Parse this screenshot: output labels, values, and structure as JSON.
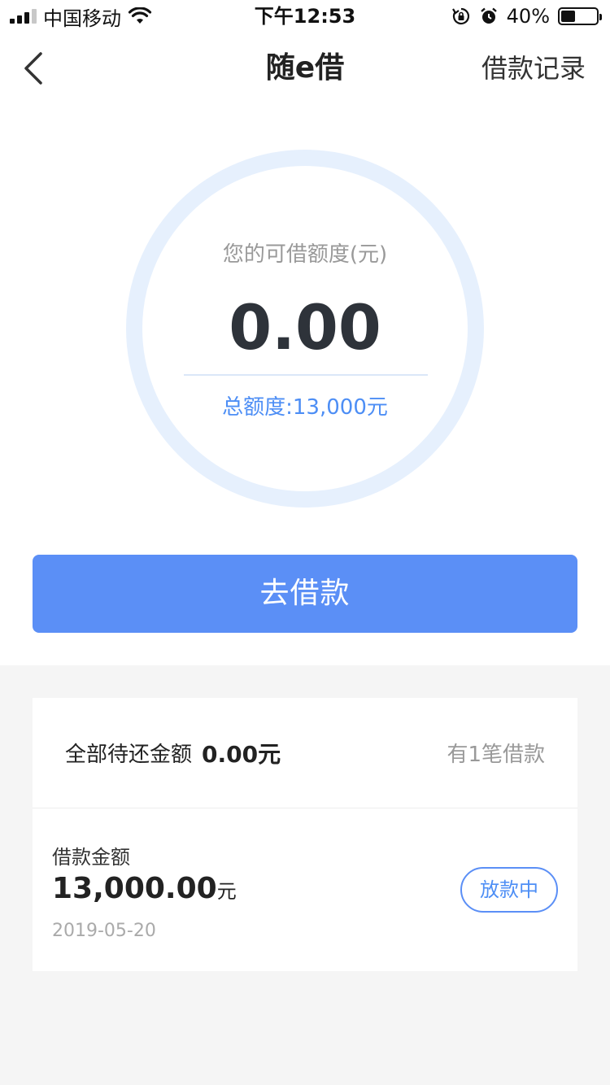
{
  "status_bar": {
    "carrier": "中国移动",
    "time": "下午12:53",
    "battery_percent": "40%",
    "battery_level": 0.4,
    "icons": [
      "signal-icon",
      "wifi-icon",
      "rotation-lock-icon",
      "alarm-icon",
      "battery-icon"
    ]
  },
  "nav": {
    "back_icon": "chevron-left-icon",
    "title": "随e借",
    "right_link": "借款记录"
  },
  "credit": {
    "label": "您的可借额度(元)",
    "available": "0.00",
    "total_label": "总额度:",
    "total_value": "13,000元"
  },
  "borrow_button": "去借款",
  "summary": {
    "pending_label": "全部待还金额",
    "pending_value": "0.00元",
    "loan_count": "有1笔借款"
  },
  "loan": {
    "amount_label": "借款金额",
    "amount": "13,000.00",
    "unit": "元",
    "date": "2019-05-20",
    "status": "放款中"
  },
  "colors": {
    "accent": "#5b8ff6",
    "ring": "#e6f0fd",
    "background": "#f5f5f5"
  }
}
